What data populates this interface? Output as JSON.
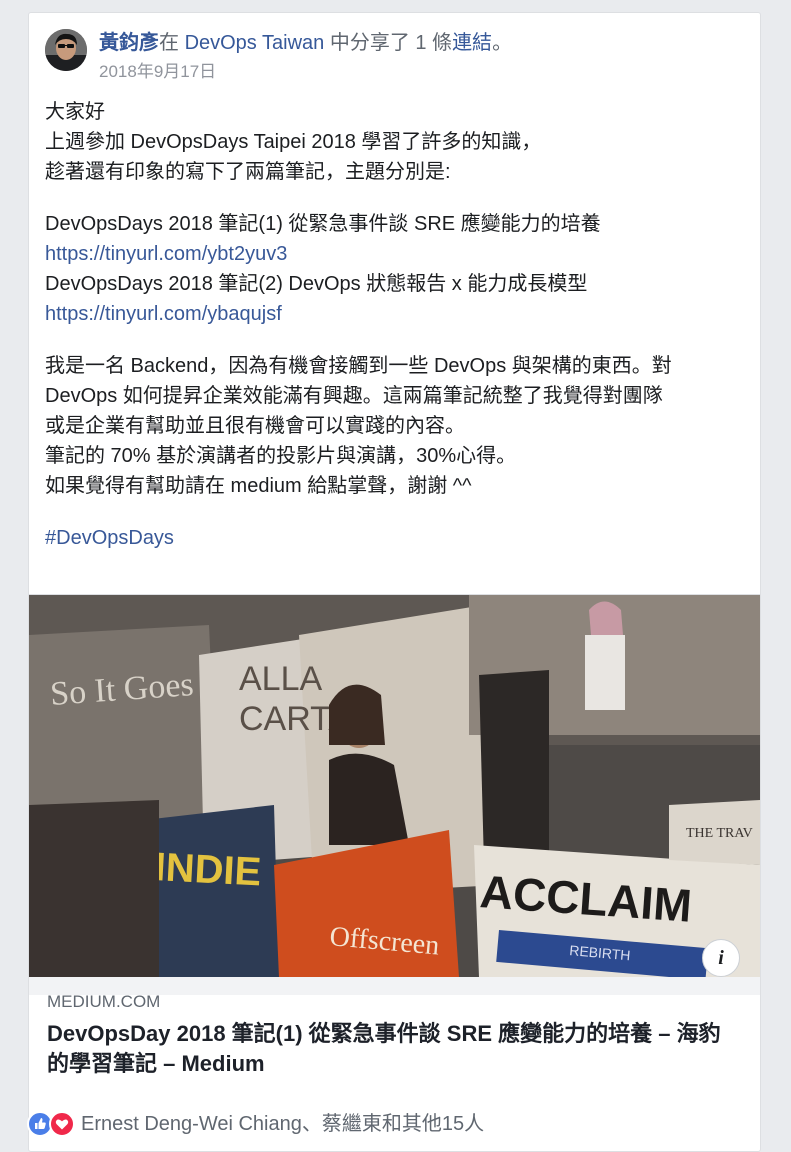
{
  "post": {
    "author_name": "黃鈞彥",
    "in_word": "在 ",
    "page_name": "DevOps Taiwan",
    "shared_text": " 中分享了 1 條",
    "link_word": "連結",
    "period": "。",
    "timestamp": "2018年9月17日"
  },
  "body": {
    "line1": "大家好",
    "line2": "上週參加 DevOpsDays Taipei 2018 學習了許多的知識，",
    "line3": "趁著還有印象的寫下了兩篇筆記，主題分別是:",
    "note1_title": "DevOpsDays 2018 筆記(1) 從緊急事件談 SRE 應變能力的培養",
    "note1_url": "https://tinyurl.com/ybt2yuv3",
    "note2_title": "DevOpsDays 2018 筆記(2) DevOps 狀態報告 x 能力成長模型",
    "note2_url": "https://tinyurl.com/ybaqujsf",
    "para3_line1": "我是一名 Backend，因為有機會接觸到一些 DevOps 與架構的東西。對",
    "para3_line2": "DevOps 如何提昇企業效能滿有興趣。這兩篇筆記統整了我覺得對團隊",
    "para3_line3": "或是企業有幫助並且很有機會可以實踐的內容。",
    "para3_line4": "筆記的 70% 基於演講者的投影片與演講，30%心得。",
    "para3_line5": "如果覺得有幫助請在 medium 給點掌聲，謝謝 ^^",
    "hashtag": "#DevOpsDays"
  },
  "link_card": {
    "domain": "MEDIUM.COM",
    "title": "DevOpsDay 2018 筆記(1) 從緊急事件談 SRE 應變能力的培養 – 海豹的學習筆記 – Medium",
    "image_text_1": "So It Goes",
    "image_text_2": "ALLA",
    "image_text_3": "CARTA",
    "image_text_4": "INDIE",
    "image_text_5": "ACCLAIM",
    "image_text_6": "Offscreen",
    "image_text_7": "THE TRAV",
    "image_text_8": "REBIRTH",
    "info_glyph": "i"
  },
  "reactions": {
    "text": "Ernest Deng-Wei Chiang、蔡繼東和其他15人"
  },
  "colors": {
    "link": "#385898",
    "author": "#365899",
    "secondary_text": "#606770",
    "like": "#4a7ee8",
    "love": "#f0284a"
  },
  "icons": {
    "like": "thumbs-up-icon",
    "love": "heart-icon",
    "info": "info-icon"
  }
}
